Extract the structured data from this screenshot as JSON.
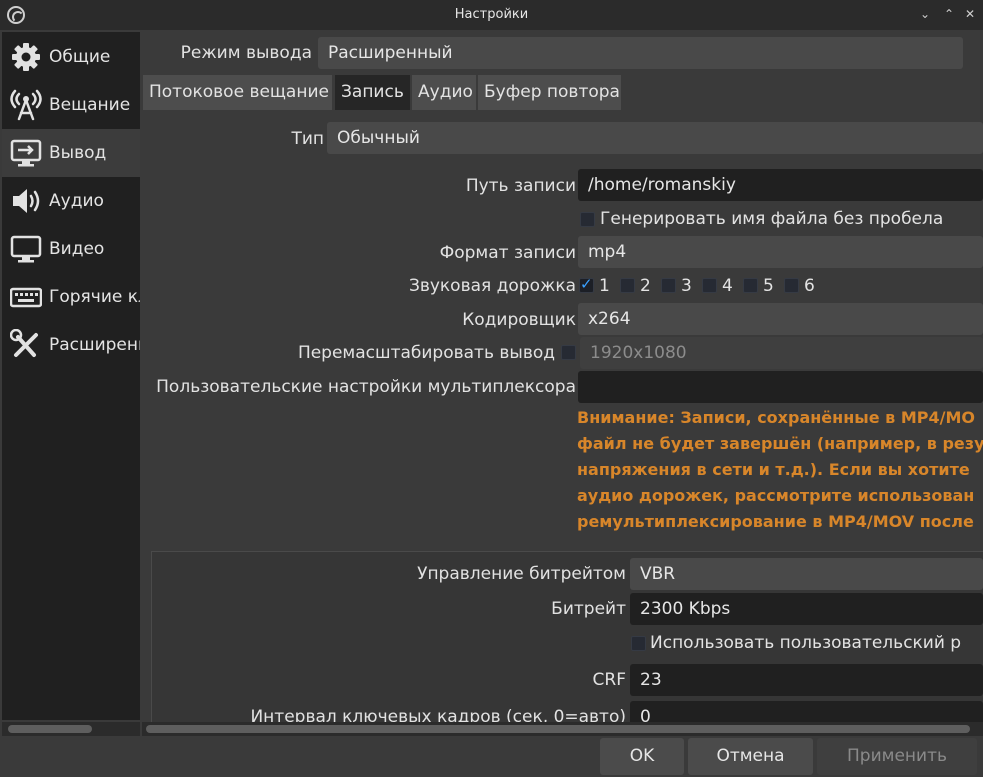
{
  "window": {
    "title": "Настройки",
    "min": "⌄",
    "max": "⌃",
    "close": "✕"
  },
  "sidebar": {
    "items": [
      {
        "label": "Общие",
        "icon": "gear-icon"
      },
      {
        "label": "Вещание",
        "icon": "broadcast-antenna-icon"
      },
      {
        "label": "Вывод",
        "icon": "output-monitor-icon"
      },
      {
        "label": "Аудио",
        "icon": "speaker-icon"
      },
      {
        "label": "Видео",
        "icon": "monitor-icon"
      },
      {
        "label": "Горячие кл",
        "icon": "keyboard-icon"
      },
      {
        "label": "Расширени",
        "icon": "tools-icon"
      }
    ]
  },
  "output_mode": {
    "label": "Режим вывода",
    "value": "Расширенный"
  },
  "tabs": [
    "Потоковое вещание",
    "Запись",
    "Аудио",
    "Буфер повтора"
  ],
  "recording": {
    "type_label": "Тип",
    "type_value": "Обычный",
    "path_label": "Путь записи",
    "path_value": "/home/romanskiy",
    "nospace_label": "Генерировать имя файла без пробела",
    "format_label": "Формат записи",
    "format_value": "mp4",
    "tracks_label": "Звуковая дорожка",
    "tracks": [
      "1",
      "2",
      "3",
      "4",
      "5",
      "6"
    ],
    "encoder_label": "Кодировщик",
    "encoder_value": "x264",
    "rescale_label": "Перемасштабировать вывод",
    "rescale_value": "1920x1080",
    "muxer_label": "Пользовательские настройки мультиплексора",
    "muxer_value": "",
    "warning_lines": [
      "Внимание: Записи, сохранённые в MP4/MO",
      "файл не будет завершён (например, в резу",
      "напряжения в сети и т.д.). Если вы хотите",
      "аудио дорожек, рассмотрите использован",
      "ремультиплексирование в MP4/MOV после"
    ]
  },
  "encoder_settings": {
    "rate_control_label": "Управление битрейтом",
    "rate_control_value": "VBR",
    "bitrate_label": "Битрейт",
    "bitrate_value": "2300 Kbps",
    "custom_buffer_label": "Использовать пользовательский р",
    "crf_label": "CRF",
    "crf_value": "23",
    "keyint_label": "Интервал ключевых кадров (сек, 0=авто)",
    "keyint_value": "0"
  },
  "buttons": {
    "ok": "OK",
    "cancel": "Отмена",
    "apply": "Применить"
  },
  "colors": {
    "warning": "#d8862a",
    "accent": "#3aa0ff"
  }
}
